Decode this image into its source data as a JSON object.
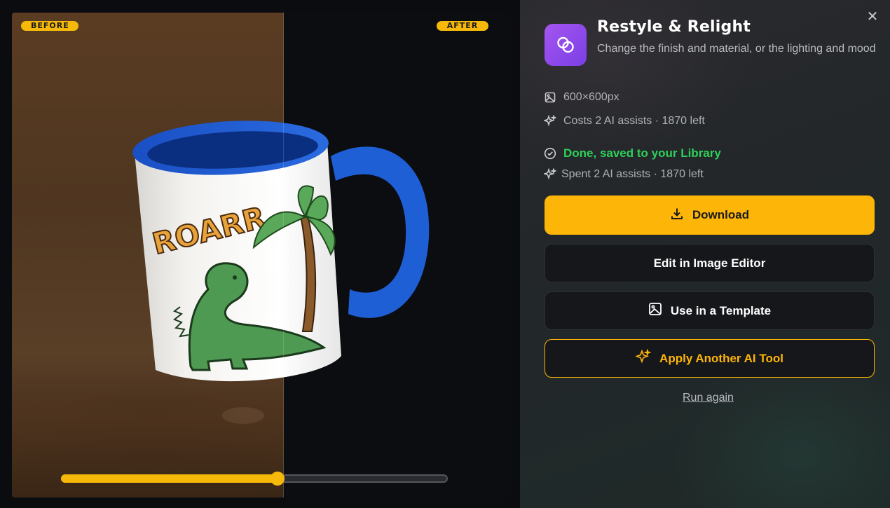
{
  "preview": {
    "before_label": "BEFORE",
    "after_label": "AFTER",
    "slider_fraction": 0.56,
    "mug_text": "ROARR"
  },
  "panel": {
    "title": "Restyle & Relight",
    "subtitle": "Change the finish and material, or the lighting and mood",
    "dimensions": "600×600px",
    "cost": "Costs 2 AI assists · 1870 left",
    "status": "Done, saved to your Library",
    "spent": "Spent 2 AI assists · 1870 left",
    "download_label": "Download",
    "editor_label": "Edit in Image Editor",
    "template_label": "Use in a Template",
    "ai_label": "Apply Another AI Tool",
    "run_again_label": "Run again",
    "close_glyph": "✕"
  },
  "colors": {
    "accent": "#fdb508",
    "success": "#2fcf5a",
    "app_icon": "#8b45ea",
    "mug_blue": "#1f5fd6"
  },
  "icons": {
    "app": "linked-circles-icon",
    "dimensions": "image-icon",
    "cost": "sparkles-icon",
    "status": "check-circle-icon",
    "download": "download-icon",
    "template": "image-icon",
    "ai": "sparkles-icon",
    "close": "close-icon"
  }
}
